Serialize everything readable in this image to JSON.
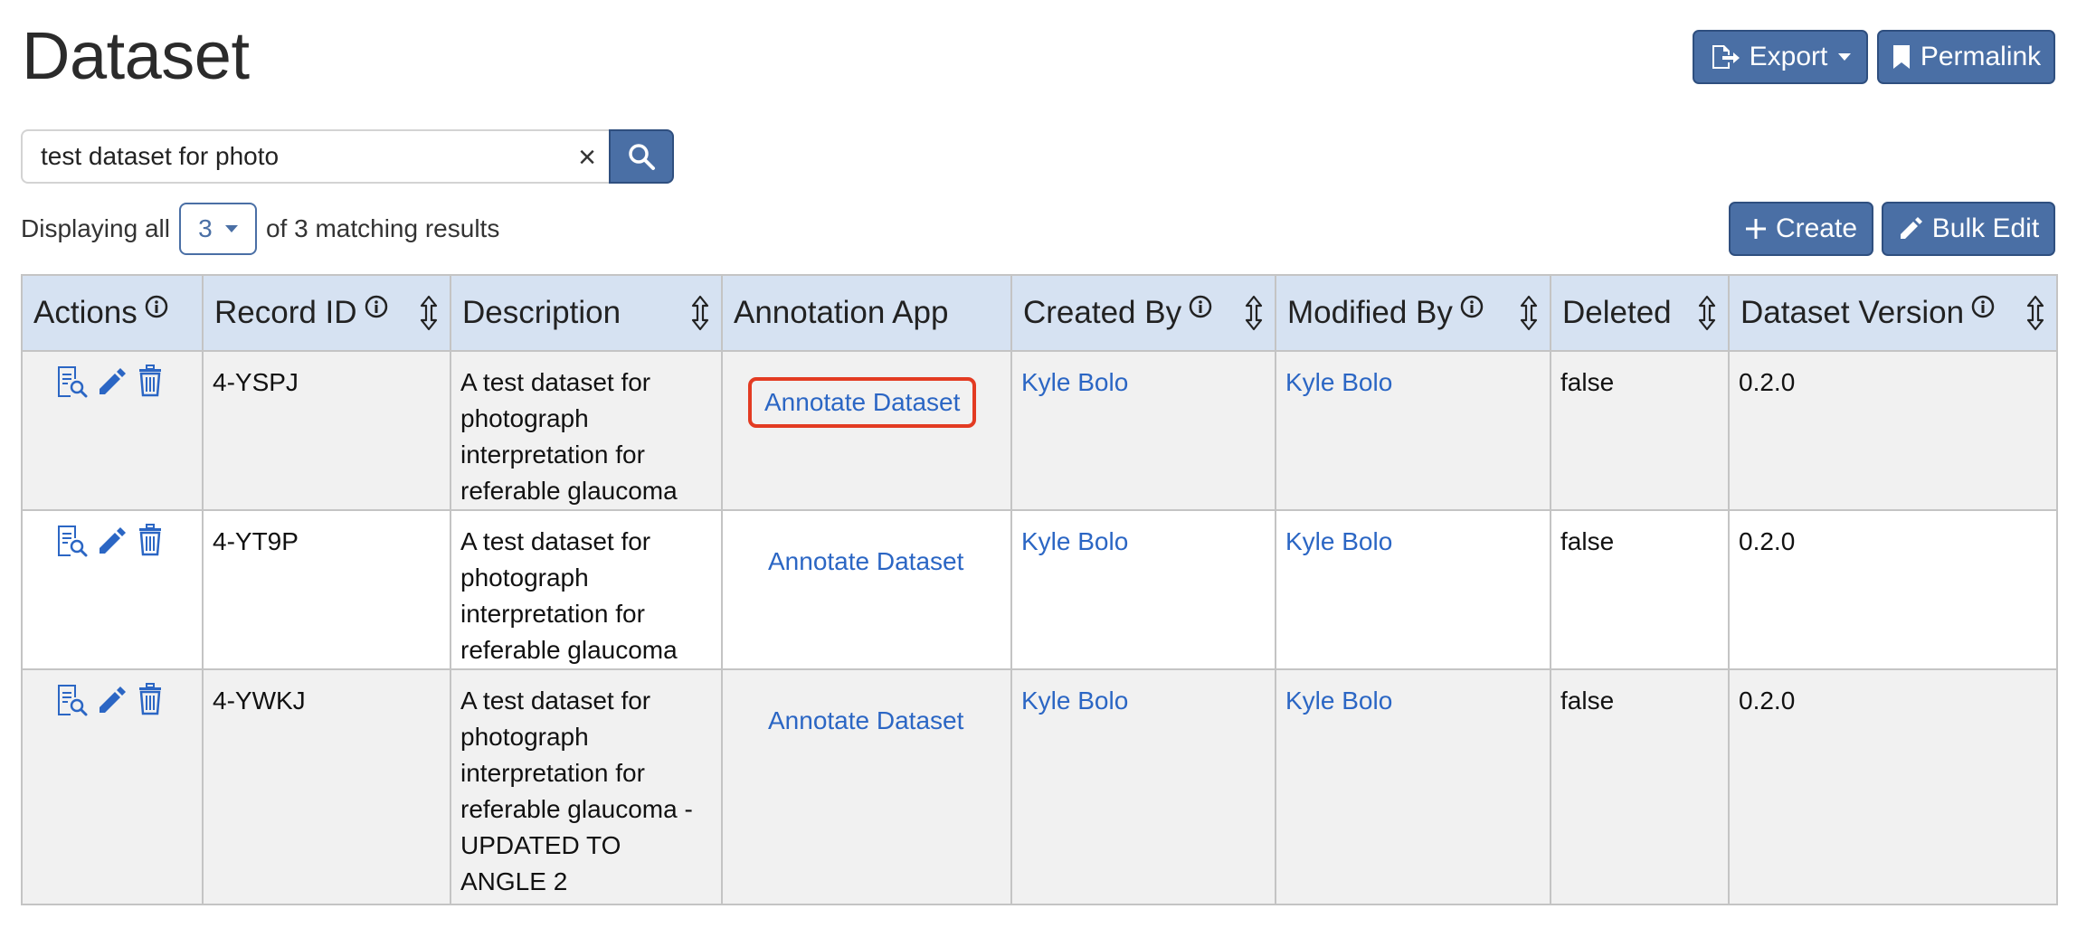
{
  "page": {
    "title": "Dataset"
  },
  "toolbar": {
    "export_label": "Export",
    "permalink_label": "Permalink",
    "create_label": "Create",
    "bulk_edit_label": "Bulk Edit"
  },
  "search": {
    "value": "test dataset for photo",
    "clear_symbol": "×"
  },
  "results": {
    "prefix": "Displaying all",
    "count": "3",
    "suffix": "of 3 matching results"
  },
  "table": {
    "columns": [
      {
        "label": "Actions",
        "info": true,
        "sortable": false
      },
      {
        "label": "Record ID",
        "info": true,
        "sortable": true
      },
      {
        "label": "Description",
        "info": false,
        "sortable": true
      },
      {
        "label": "Annotation App",
        "info": false,
        "sortable": false
      },
      {
        "label": "Created By",
        "info": true,
        "sortable": true
      },
      {
        "label": "Modified By",
        "info": true,
        "sortable": true
      },
      {
        "label": "Deleted",
        "info": false,
        "sortable": true
      },
      {
        "label": "Dataset Version",
        "info": true,
        "sortable": true
      }
    ],
    "rows": [
      {
        "record_id": "4-YSPJ",
        "description": "A test dataset for photograph interpretation for referable glaucoma",
        "annotation_app": "Annotate Dataset",
        "created_by": "Kyle Bolo",
        "modified_by": "Kyle Bolo",
        "deleted": "false",
        "dataset_version": "0.2.0"
      },
      {
        "record_id": "4-YT9P",
        "description": "A test dataset for photograph interpretation for referable glaucoma",
        "annotation_app": "Annotate Dataset",
        "created_by": "Kyle Bolo",
        "modified_by": "Kyle Bolo",
        "deleted": "false",
        "dataset_version": "0.2.0"
      },
      {
        "record_id": "4-YWKJ",
        "description": "A test dataset for photograph interpretation for referable glaucoma - UPDATED TO ANGLE 2",
        "annotation_app": "Annotate Dataset",
        "created_by": "Kyle Bolo",
        "modified_by": "Kyle Bolo",
        "deleted": "false",
        "dataset_version": "0.2.0"
      }
    ]
  },
  "icons": {
    "export": "file-export-icon",
    "permalink": "bookmark-icon",
    "create": "plus-icon",
    "bulk_edit": "pencil-icon",
    "search": "search-icon",
    "info": "info-circle-icon",
    "sort": "sort-arrows-icon",
    "view": "view-record-icon",
    "edit": "pencil-icon",
    "delete": "trash-icon"
  },
  "colors": {
    "primary": "#4a6fa5",
    "header_bg": "#d6e2f2",
    "link": "#2b66c4",
    "highlight": "#e33b22"
  }
}
